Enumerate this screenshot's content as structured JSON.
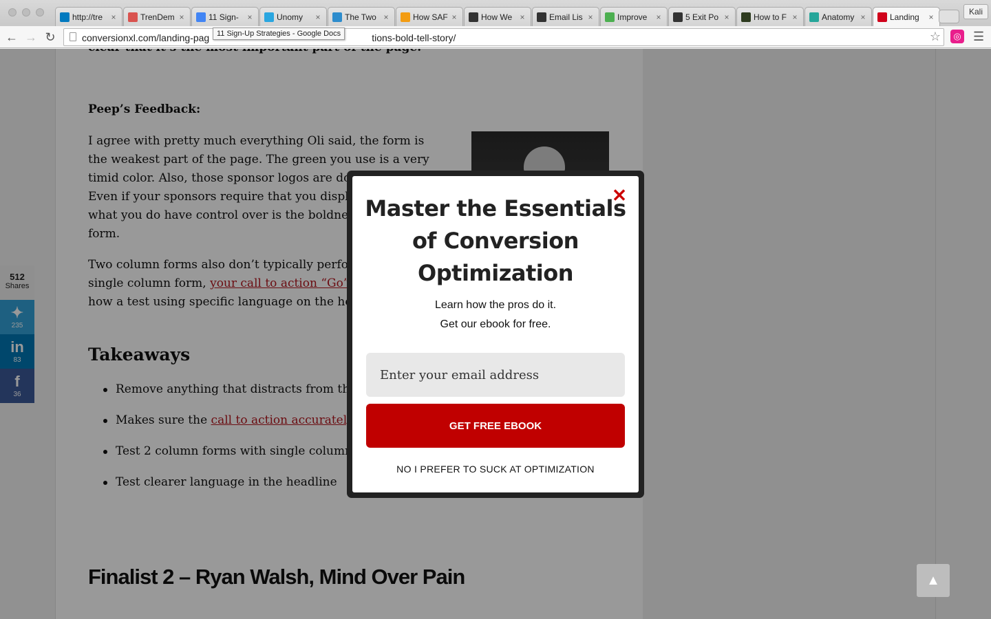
{
  "browser": {
    "tabs": [
      {
        "title": "http://tre",
        "icon": "trello-icon",
        "icon_color": "#0079bf",
        "active": false
      },
      {
        "title": "TrenDem",
        "icon": "trendemon-icon",
        "icon_color": "#d9534f",
        "active": false
      },
      {
        "title": "11 Sign-",
        "icon": "google-docs-icon",
        "icon_color": "#4285f4",
        "active": false
      },
      {
        "title": "Unomy",
        "icon": "unomy-icon",
        "icon_color": "#2aa6e0",
        "active": false
      },
      {
        "title": "The Two",
        "icon": "wave-icon",
        "icon_color": "#2d8ccd",
        "active": false
      },
      {
        "title": "How SAF",
        "icon": "orange-circle-icon",
        "icon_color": "#f39c12",
        "active": false
      },
      {
        "title": "How We",
        "icon": "layers-icon",
        "icon_color": "#333333",
        "active": false
      },
      {
        "title": "Email Lis",
        "icon": "layers-icon",
        "icon_color": "#333333",
        "active": false
      },
      {
        "title": "Improve",
        "icon": "leaf-icon",
        "icon_color": "#4caf50",
        "active": false
      },
      {
        "title": "5 Exit Po",
        "icon": "panda-icon",
        "icon_color": "#333333",
        "active": false
      },
      {
        "title": "How to F",
        "icon": "ad-icon",
        "icon_color": "#2e3b1f",
        "active": false
      },
      {
        "title": "Anatomy",
        "icon": "m-icon",
        "icon_color": "#26a69a",
        "active": false
      },
      {
        "title": "Landing",
        "icon": "xl-icon",
        "icon_color": "#d0021b",
        "active": true
      }
    ],
    "profile_name": "Kali",
    "url": "conversionxl.com/landing-pag",
    "url_tail": "tions-bold-tell-story/",
    "tooltip": "11 Sign-Up Strategies - Google Docs"
  },
  "article": {
    "cut_line": "clear that it’s the most important part of the page.",
    "feedback_heading": "Peep’s Feedback:",
    "para1": "I agree with pretty much everything Oli said, the form is the weakest part of the page. The green you use is a very timid color. Also, those sponsor logos are dominat",
    "para1_line4": "Even if your sponsors require that you displ",
    "para1_line5": "what you do have control over is the boldne",
    "para1_line6": "form.",
    "para2_start": "Two column forms also don’t typically perfo",
    "para2_line2_start": "single column form, ",
    "para2_link": "your call to action “Go”",
    "para2_line3": "how a test using specific language on the he",
    "takeaways_heading": "Takeaways",
    "takeaways": [
      {
        "text": "Remove anything that distracts from th",
        "link": ""
      },
      {
        "text": "Makes sure the ",
        "link": "call to action accurately"
      },
      {
        "text": "Test 2 column forms with single column",
        "link": ""
      },
      {
        "text": "Test clearer language in the headline",
        "link": ""
      }
    ],
    "finalist_heading": "Finalist 2 – Ryan Walsh, Mind Over Pain"
  },
  "social": {
    "shares_count": "512",
    "shares_label": "Shares",
    "twitter_count": "235",
    "linkedin_count": "83",
    "facebook_count": "36"
  },
  "modal": {
    "title": "Master the Essentials of Conversion Optimization",
    "subtitle_line1": "Learn how the pros do it.",
    "subtitle_line2": "Get our ebook for free.",
    "email_placeholder": "Enter your email address",
    "cta_label": "GET FREE EBOOK",
    "decline_label": "NO I PREFER TO SUCK AT OPTIMIZATION",
    "close_symbol": "✕",
    "accent_color": "#c00000"
  },
  "back_to_top_symbol": "▲"
}
